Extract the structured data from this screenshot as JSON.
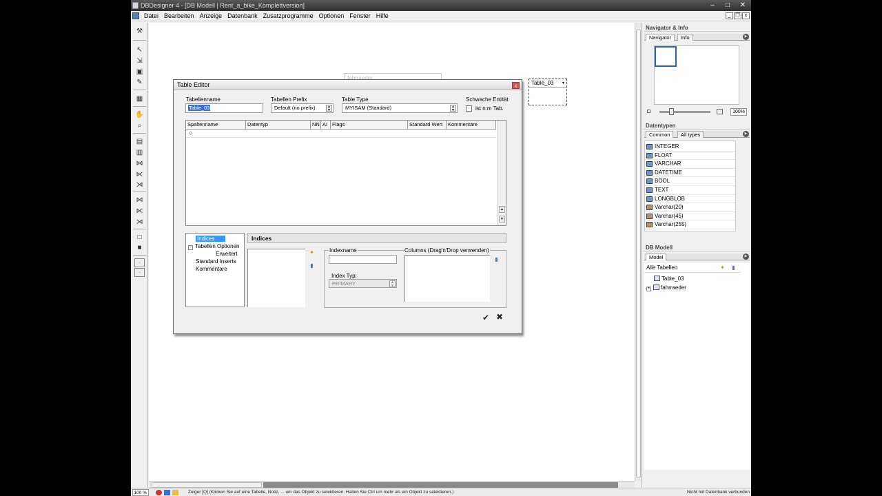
{
  "window": {
    "title": "DBDesigner 4 - [DB Modell | Rent_a_bike_Komplettversion]",
    "min": "–",
    "max": "□",
    "close": "✕"
  },
  "menu": {
    "items": [
      "Datei",
      "Bearbeiten",
      "Anzeige",
      "Datenbank",
      "Zusatzprogramme",
      "Optionen",
      "Fenster",
      "Hilfe"
    ],
    "mdi": [
      "_",
      "❐",
      "x"
    ]
  },
  "canvas": {
    "ghost_table": "fahrraeder",
    "table_box_title": "Table_03",
    "table_box_arrow": "▾"
  },
  "editor": {
    "title": "Table Editor",
    "close": "x",
    "tabellenname_label": "Tabellenname",
    "tabellenname_value": "Table_03",
    "prefix_label": "Tabellen Prefix",
    "prefix_value": "Default (no prefix)",
    "type_label": "Table Type",
    "type_value": "MYISAM  (Standard)",
    "weak_label": "Schwache Entität",
    "nm_label": "ist n:m Tab.",
    "grid_headers": [
      "Spaltenname",
      "Datentyp",
      "NN",
      "AI",
      "Flags",
      "Standard Wert",
      "Kommentare"
    ],
    "row_marker": "◇",
    "tree": {
      "indices": "Indices",
      "tabellen_optionen": "Tabellen Optionen",
      "erweitert": "Erweitert",
      "standard_inserts": "Standard Inserts",
      "kommentare": "Kommentare",
      "expander": "−"
    },
    "panel_title": "Indices",
    "indexname_label": "Indexname",
    "columns_label": "Columns (Drag'n'Drop verwenden)",
    "index_typ_label": "Index Typ:",
    "index_typ_value": "PRIMARY",
    "ok": "✔",
    "cancel": "✖"
  },
  "right_panel": {
    "navigator_head": "Navigator & Info",
    "nav_tabs": [
      "Navigator",
      "Info"
    ],
    "zoom": "100%",
    "datentypen_head": "Datentypen",
    "dt_tabs": [
      "Common",
      "All types"
    ],
    "datatypes": [
      "INTEGER",
      "FLOAT",
      "VARCHAR",
      "DATETIME",
      "BOOL",
      "TEXT",
      "LONGBLOB",
      "Varchar(20)",
      "Varchar(45)",
      "Varchar(255)"
    ],
    "model_head": "DB Modell",
    "model_tabs": [
      "Model"
    ],
    "alle_tabellen": "Alle Tabellen",
    "tables": [
      "Table_03",
      "fahrraeder"
    ],
    "expander": "+"
  },
  "status": {
    "zoom": "100 %",
    "text": "Zeiger [Q] (Klicken Sie auf eine Tabelle, Notiz, ... um das Objekt zu selektieren. Halten Sie Ctrl um mehr als ein Objekt zu selektieren.)",
    "right": "Nicht mit Datenbank verbunden"
  },
  "colors": {
    "selection": "#3399ff",
    "titlebar": "#2e2e2e",
    "text_selection": "#3a6fd8"
  }
}
